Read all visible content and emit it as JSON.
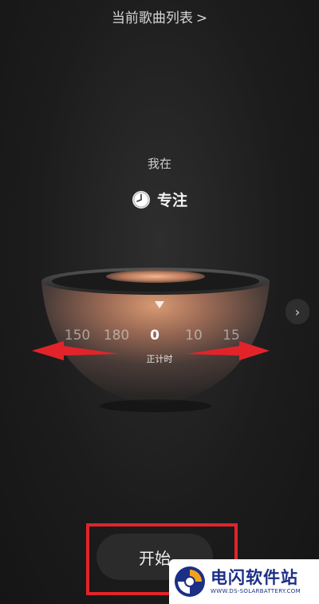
{
  "header": {
    "playlist_label": "当前歌曲列表",
    "chevron": ">"
  },
  "status": {
    "label": "我在"
  },
  "mode": {
    "label": "专注",
    "icon": "clock-icon"
  },
  "dial": {
    "ticks": [
      "150",
      "180",
      "0",
      "10",
      "15"
    ],
    "selected": "0",
    "timer_mode": "正计时"
  },
  "side_button": {
    "icon": "chevron-right-icon",
    "glyph": "›"
  },
  "start": {
    "label": "开始"
  },
  "watermark": {
    "title": "电闪软件站",
    "url": "WWW.DS-SOLARBATTERY.COM"
  },
  "colors": {
    "highlight": "#e2242a",
    "bowl_glow": "#e6a47a",
    "watermark_text": "#1b2f86"
  }
}
